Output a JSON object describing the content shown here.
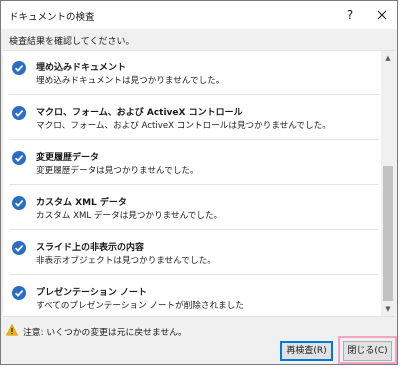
{
  "dialog": {
    "title": "ドキュメントの検査",
    "help_label": "?",
    "instruction": "検査結果を確認してください。"
  },
  "results": [
    {
      "title": "埋め込みドキュメント",
      "description": "埋め込みドキュメントは見つかりませんでした。",
      "icon": "check-circle-icon"
    },
    {
      "title": "マクロ、フォーム、および ActiveX コントロール",
      "description": "マクロ、フォーム、および ActiveX コントロールは見つかりませんでした。",
      "icon": "check-circle-icon"
    },
    {
      "title": "変更履歴データ",
      "description": "変更履歴データは見つかりませんでした。",
      "icon": "check-circle-icon"
    },
    {
      "title": "カスタム XML データ",
      "description": "カスタム XML データは見つかりませんでした。",
      "icon": "check-circle-icon"
    },
    {
      "title": "スライド上の非表示の内容",
      "description": "非表示オブジェクトは見つかりませんでした。",
      "icon": "check-circle-icon"
    },
    {
      "title": "プレゼンテーション ノート",
      "description": "すべてのプレゼンテーション ノートが削除されました",
      "icon": "check-circle-icon"
    }
  ],
  "footer": {
    "warning": "注意: いくつかの変更は元に戻せません。",
    "reinspect_label": "再検査(R)",
    "close_label": "閉じる(C)"
  },
  "colors": {
    "check": "#2b6cc4",
    "warning": "#f2b600",
    "highlight": "#f2a6c6",
    "focus": "#0078d7"
  }
}
